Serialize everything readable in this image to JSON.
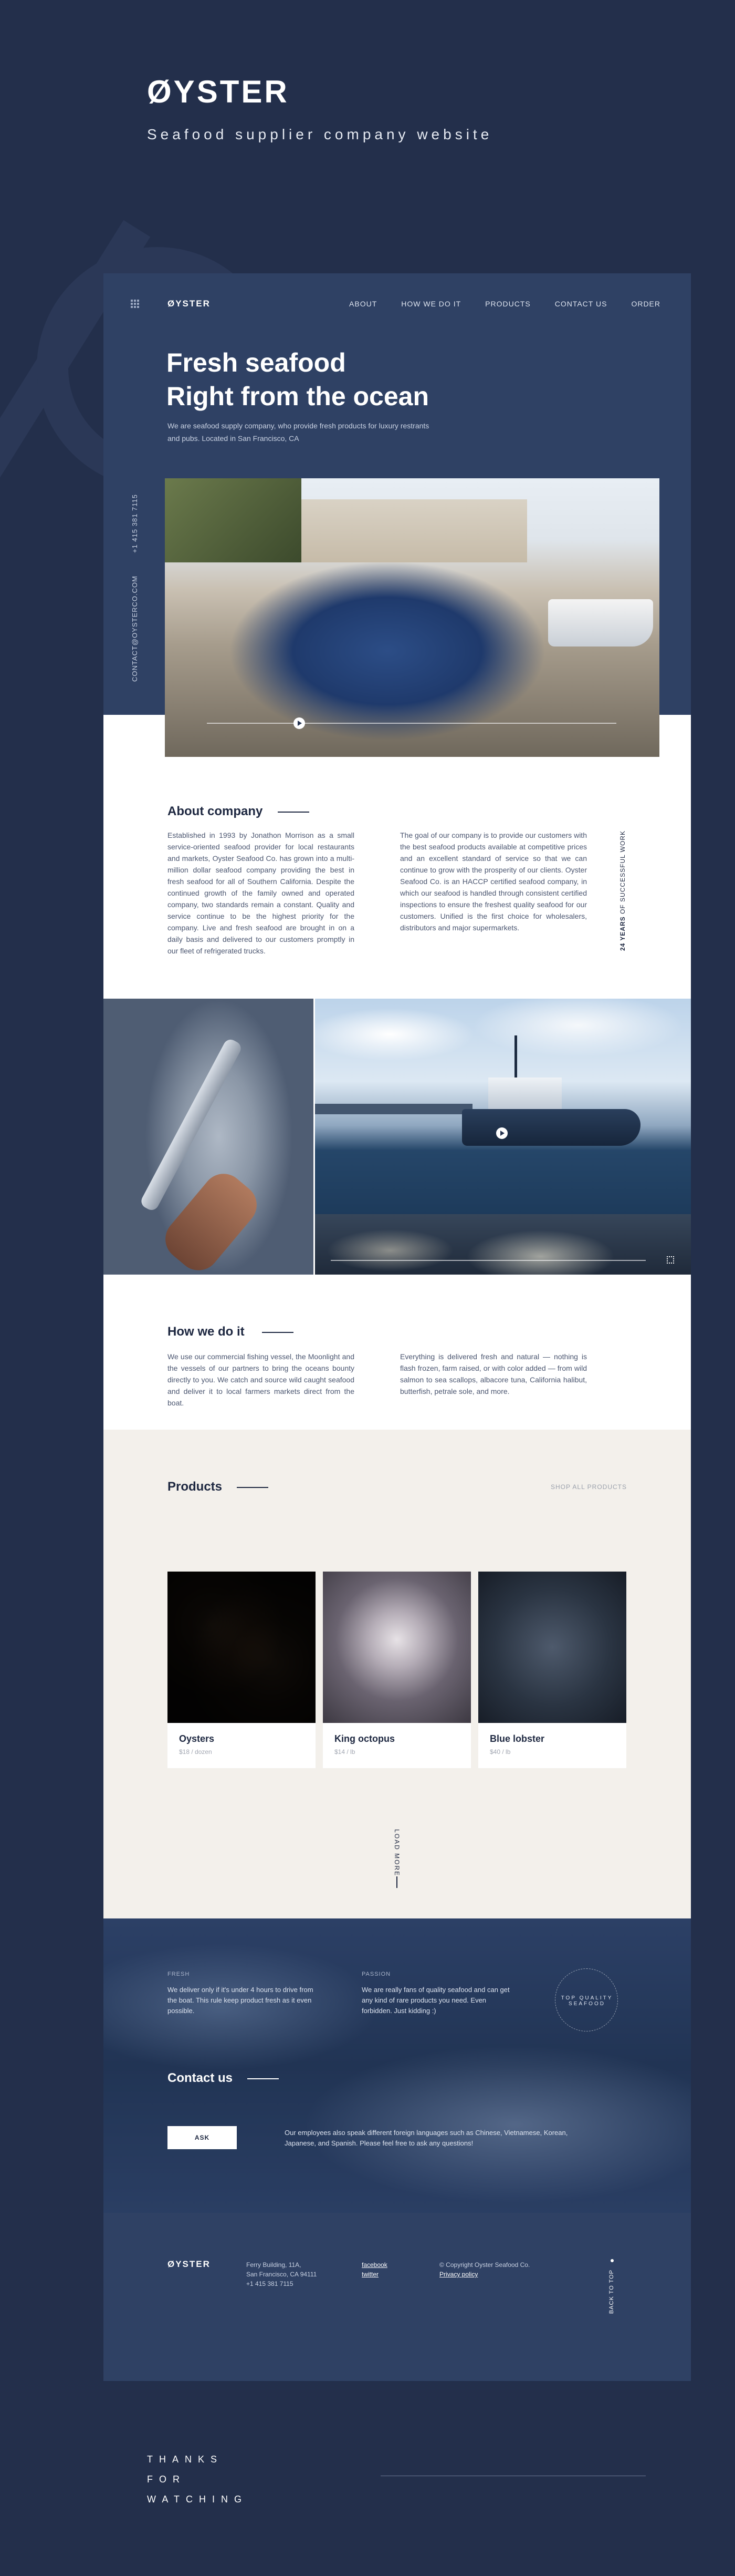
{
  "presentation": {
    "logo": "ØYSTER",
    "subtitle": "Seafood supplier company website",
    "thanks": [
      "THANKS",
      "FOR",
      "WATCHING"
    ]
  },
  "header": {
    "logo": "ØYSTER",
    "nav": [
      "ABOUT",
      "HOW WE DO IT",
      "PRODUCTS",
      "CONTACT US",
      "ORDER"
    ]
  },
  "hero": {
    "title_line1": "Fresh seafood",
    "title_line2": "Right from the ocean",
    "description": "We are seafood supply company, who provide fresh products for luxury restrants and pubs. Located in San Francisco, CA",
    "phone": "+1 415 381 7115",
    "email": "CONTACT@OYSTERCO.COM"
  },
  "about": {
    "title": "About company",
    "col1": "Established in 1993 by Jonathon Morrison as a small service-oriented seafood provider for local restaurants and markets, Oyster Seafood Co. has grown into a multi-million dollar seafood company providing the best in fresh seafood for all of Southern California. Despite the continued growth of the family owned and operated company, two standards remain a constant. Quality and service continue to be the highest priority for the company. Live and fresh seafood are brought in on a daily basis and delivered to our customers promptly in our fleet of refrigerated trucks.",
    "col2": "The goal of our company is to provide our customers with the best seafood products available at competitive prices and an excellent standard of service so that we can continue to grow with the prosperity of our clients. Oyster Seafood Co. is an HACCP certified seafood company, in which our seafood is handled through consistent certified inspections to ensure the freshest quality seafood for our customers. Unified is the first choice for wholesalers, distributors and major supermarkets.",
    "years_bold": "24 YEARS",
    "years_rest": " OF SUCCESSFUL WORK"
  },
  "how": {
    "title": "How we do it",
    "col1": "We use our commercial fishing vessel, the Moonlight and the vessels of our partners to bring the oceans bounty directly to you. We catch and source wild caught seafood and deliver it to local farmers markets direct from the boat.",
    "col2": "Everything is delivered fresh and natural — nothing is flash frozen, farm raised, or with color added — from wild salmon to sea scallops, albacore tuna, California halibut, butterfish, petrale sole, and more."
  },
  "products": {
    "title": "Products",
    "shop_all": "SHOP ALL PRODUCTS",
    "load_more": "LOAD MORE",
    "items": [
      {
        "name": "Oysters",
        "price": "$18 / dozen"
      },
      {
        "name": "King octopus",
        "price": "$14 / lb"
      },
      {
        "name": "Blue lobster",
        "price": "$40 / lb"
      }
    ]
  },
  "contact": {
    "fresh_label": "FRESH",
    "fresh_text": "We deliver only if it's under 4 hours to drive from the boat. This rule keep product fresh as it even possible.",
    "passion_label": "PASSION",
    "passion_text": "We are really fans of quality seafood and can get any kind of rare products you need. Even forbidden. Just kidding :)",
    "ring_text": "TOP QUALITY SEAFOOD",
    "title": "Contact us",
    "ask": "ASK",
    "note": "Our employees also speak different foreign languages such as Chinese, Vietnamese, Korean, Japanese, and Spanish. Please feel free to ask any questions!"
  },
  "footer": {
    "logo": "ØYSTER",
    "address1": "Ferry Building, 11A,",
    "address2": "San Francisco, CA 94111",
    "phone": "+1 415 381 7115",
    "facebook": "facebook",
    "twitter": "twitter",
    "copyright": "© Copyright Oyster Seafood Co.",
    "privacy": "Privacy policy",
    "back_to_top": "BACK TO TOP"
  }
}
